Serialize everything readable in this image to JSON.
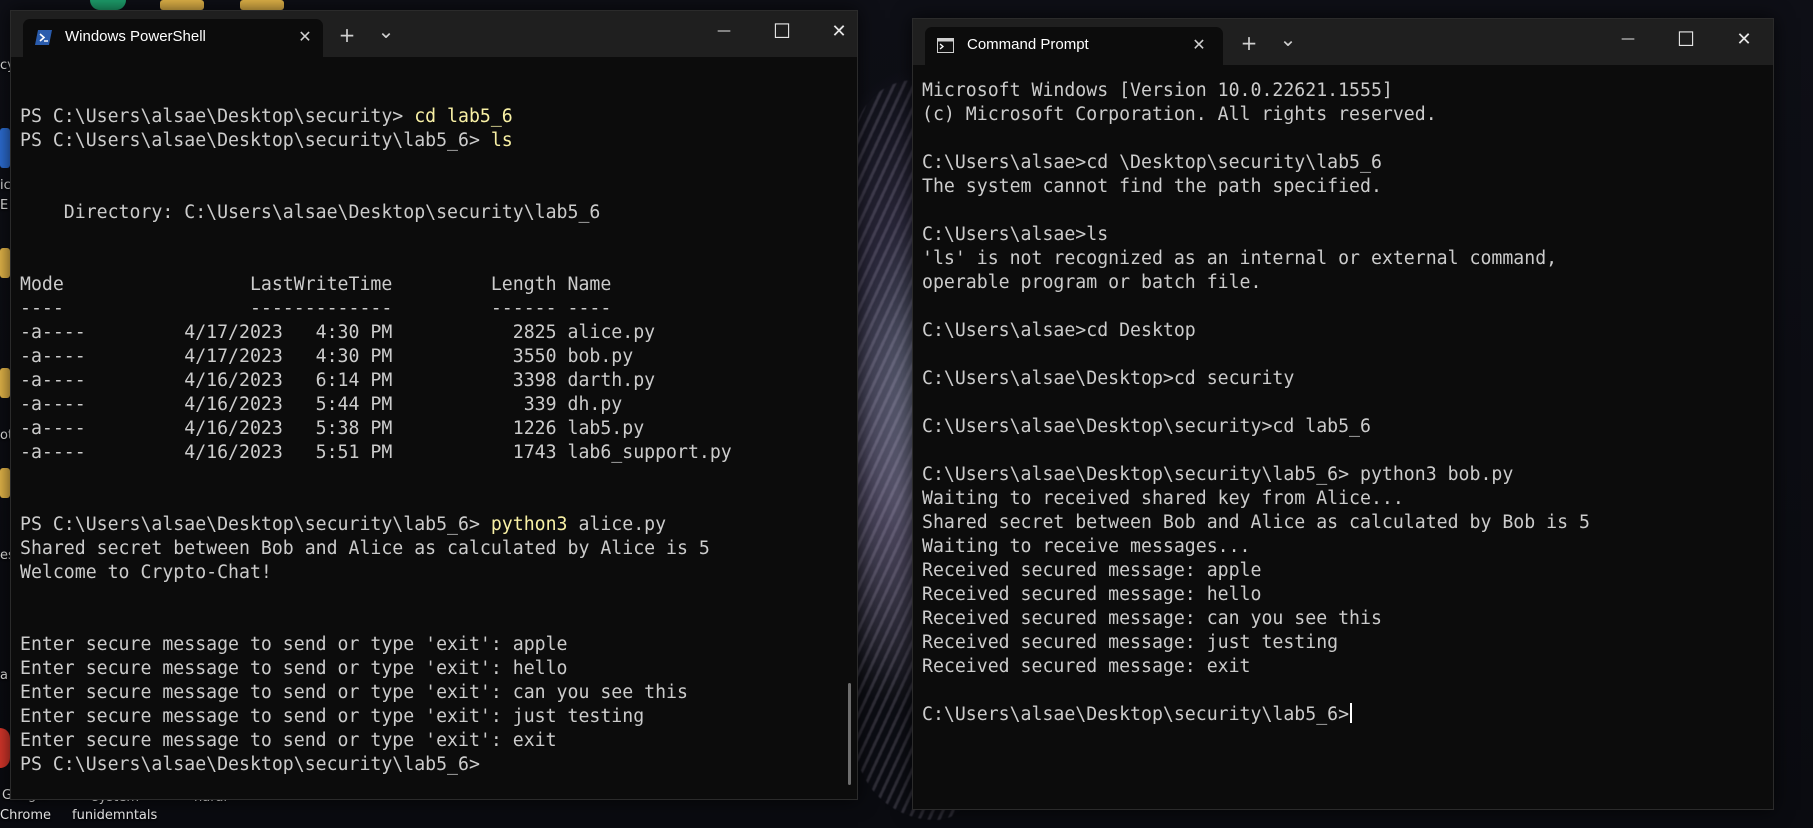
{
  "desktop": {
    "labels": [
      "Google",
      "Chrome",
      "system",
      "funidemntals",
      "harar"
    ],
    "edge_text": [
      "cy",
      "ic",
      "E",
      "a",
      "es",
      "ot"
    ]
  },
  "powershell": {
    "tab_title": "Windows PowerShell",
    "new_tab": "+",
    "dropdown": "⌄",
    "minimize": "—",
    "maximize": "☐",
    "close": "✕",
    "lines": [
      {
        "text": ""
      },
      {
        "text": ""
      },
      {
        "prompt": "PS C:\\Users\\alsae\\Desktop\\security> ",
        "cmd": "cd lab5_6"
      },
      {
        "prompt": "PS C:\\Users\\alsae\\Desktop\\security\\lab5_6> ",
        "cmd": "ls"
      },
      {
        "text": ""
      },
      {
        "text": ""
      },
      {
        "text": "    Directory: C:\\Users\\alsae\\Desktop\\security\\lab5_6"
      },
      {
        "text": ""
      },
      {
        "text": ""
      },
      {
        "text": "Mode                 LastWriteTime         Length Name"
      },
      {
        "text": "----                 -------------         ------ ----"
      },
      {
        "text": "-a----         4/17/2023   4:30 PM           2825 alice.py"
      },
      {
        "text": "-a----         4/17/2023   4:30 PM           3550 bob.py"
      },
      {
        "text": "-a----         4/16/2023   6:14 PM           3398 darth.py"
      },
      {
        "text": "-a----         4/16/2023   5:44 PM            339 dh.py"
      },
      {
        "text": "-a----         4/16/2023   5:38 PM           1226 lab5.py"
      },
      {
        "text": "-a----         4/16/2023   5:51 PM           1743 lab6_support.py"
      },
      {
        "text": ""
      },
      {
        "text": ""
      },
      {
        "prompt": "PS C:\\Users\\alsae\\Desktop\\security\\lab5_6> ",
        "cmd": "python3",
        "rest": " alice.py"
      },
      {
        "text": "Shared secret between Bob and Alice as calculated by Alice is 5"
      },
      {
        "text": "Welcome to Crypto-Chat!"
      },
      {
        "text": ""
      },
      {
        "text": ""
      },
      {
        "text": "Enter secure message to send or type 'exit': apple"
      },
      {
        "text": "Enter secure message to send or type 'exit': hello"
      },
      {
        "text": "Enter secure message to send or type 'exit': can you see this"
      },
      {
        "text": "Enter secure message to send or type 'exit': just testing"
      },
      {
        "text": "Enter secure message to send or type 'exit': exit"
      },
      {
        "text": "PS C:\\Users\\alsae\\Desktop\\security\\lab5_6> "
      }
    ]
  },
  "cmd": {
    "tab_title": "Command Prompt",
    "new_tab": "+",
    "dropdown": "⌄",
    "minimize": "—",
    "maximize": "☐",
    "close": "✕",
    "lines": [
      {
        "text": "Microsoft Windows [Version 10.0.22621.1555]"
      },
      {
        "text": "(c) Microsoft Corporation. All rights reserved."
      },
      {
        "text": ""
      },
      {
        "text": "C:\\Users\\alsae>cd \\Desktop\\security\\lab5_6"
      },
      {
        "text": "The system cannot find the path specified."
      },
      {
        "text": ""
      },
      {
        "text": "C:\\Users\\alsae>ls"
      },
      {
        "text": "'ls' is not recognized as an internal or external command,"
      },
      {
        "text": "operable program or batch file."
      },
      {
        "text": ""
      },
      {
        "text": "C:\\Users\\alsae>cd Desktop"
      },
      {
        "text": ""
      },
      {
        "text": "C:\\Users\\alsae\\Desktop>cd security"
      },
      {
        "text": ""
      },
      {
        "text": "C:\\Users\\alsae\\Desktop\\security>cd lab5_6"
      },
      {
        "text": ""
      },
      {
        "text": "C:\\Users\\alsae\\Desktop\\security\\lab5_6> python3 bob.py"
      },
      {
        "text": "Waiting to received shared key from Alice..."
      },
      {
        "text": "Shared secret between Bob and Alice as calculated by Bob is 5"
      },
      {
        "text": "Waiting to receive messages..."
      },
      {
        "text": "Received secured message: apple"
      },
      {
        "text": "Received secured message: hello"
      },
      {
        "text": "Received secured message: can you see this"
      },
      {
        "text": "Received secured message: just testing"
      },
      {
        "text": "Received secured message: exit"
      },
      {
        "text": ""
      },
      {
        "text": "C:\\Users\\alsae\\Desktop\\security\\lab5_6>",
        "cursor": true
      }
    ]
  },
  "colors": {
    "console_bg": "#0c0c0c",
    "console_text": "#cccccc",
    "command_highlight": "#f9f1a5",
    "titlebar": "#1f1f1f",
    "powershell_icon": "#2a5cad"
  }
}
